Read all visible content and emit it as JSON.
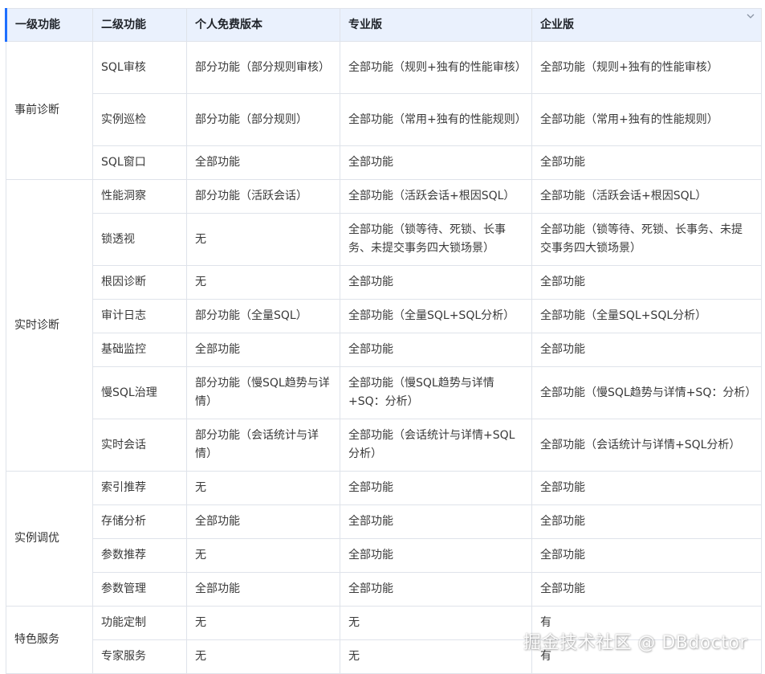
{
  "table": {
    "headers": [
      "一级功能",
      "二级功能",
      "个人免费版本",
      "专业版",
      "企业版"
    ],
    "groups": [
      {
        "name": "事前诊断",
        "rows": [
          [
            "SQL审核",
            "部分功能（部分规则审核）",
            "全部功能（规则+独有的性能审核）",
            "全部功能（规则+独有的性能审核）"
          ],
          [
            "实例巡检",
            "部分功能（部分规则）",
            "全部功能（常用+独有的性能规则）",
            "全部功能（常用+独有的性能规则）"
          ],
          [
            "SQL窗口",
            "全部功能",
            "全部功能",
            "全部功能"
          ]
        ]
      },
      {
        "name": "实时诊断",
        "rows": [
          [
            "性能洞察",
            "部分功能（活跃会话）",
            "全部功能（活跃会话+根因SQL）",
            "全部功能（活跃会话+根因SQL）"
          ],
          [
            "锁透视",
            "无",
            "全部功能（锁等待、死锁、长事务、未提交事务四大锁场景）",
            "全部功能（锁等待、死锁、长事务、未提交事务四大锁场景）"
          ],
          [
            "根因诊断",
            "无",
            "全部功能",
            "全部功能"
          ],
          [
            "审计日志",
            "部分功能（全量SQL）",
            "全部功能（全量SQL+SQL分析）",
            "全部功能（全量SQL+SQL分析）"
          ],
          [
            "基础监控",
            "全部功能",
            "全部功能",
            "全部功能"
          ],
          [
            "慢SQL治理",
            "部分功能（慢SQL趋势与详情）",
            "全部功能（慢SQL趋势与详情+SQ：分析）",
            "全部功能（慢SQL趋势与详情+SQ：分析）"
          ],
          [
            "实时会话",
            "部分功能（会话统计与详情）",
            "全部功能（会话统计与详情+SQL分析）",
            "全部功能（会话统计与详情+SQL分析）"
          ]
        ]
      },
      {
        "name": "实例调优",
        "rows": [
          [
            "索引推荐",
            "无",
            "全部功能",
            "全部功能"
          ],
          [
            "存储分析",
            "全部功能",
            "全部功能",
            "全部功能"
          ],
          [
            "参数推荐",
            "无",
            "全部功能",
            "全部功能"
          ],
          [
            "参数管理",
            "全部功能",
            "全部功能",
            "全部功能"
          ]
        ]
      },
      {
        "name": "特色服务",
        "rows": [
          [
            "功能定制",
            "无",
            "无",
            "有"
          ],
          [
            "专家服务",
            "无",
            "无",
            "有"
          ]
        ]
      }
    ]
  },
  "watermark": "掘金技术社区 @ DBdoctor",
  "icons": {
    "header_chevron": "chevron-down-icon"
  }
}
